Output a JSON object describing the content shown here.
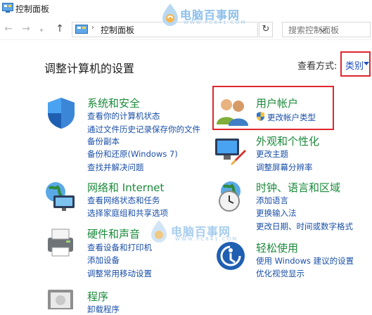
{
  "window": {
    "title": "控制面板"
  },
  "address": {
    "path": "控制面板",
    "separator": "›"
  },
  "search": {
    "placeholder": "搜索控制面板"
  },
  "watermark": {
    "brand": "电脑百事网",
    "url": "WWW.PC841.COM"
  },
  "heading": "调整计算机的设置",
  "view_by": {
    "label": "查看方式:",
    "value": "类别"
  },
  "categories": {
    "system": {
      "title": "系统和安全",
      "links": [
        "查看你的计算机状态",
        "通过文件历史记录保存你的文件",
        "备份副本",
        "备份和还原(Windows 7)",
        "查找并解决问题"
      ]
    },
    "network": {
      "title": "网络和 Internet",
      "links": [
        "查看网络状态和任务",
        "选择家庭组和共享选项"
      ]
    },
    "hardware": {
      "title": "硬件和声音",
      "links": [
        "查看设备和打印机",
        "添加设备",
        "调整常用移动设置"
      ]
    },
    "programs": {
      "title": "程序",
      "links": [
        "卸载程序"
      ]
    },
    "accounts": {
      "title": "用户帐户",
      "links": [
        "更改帐户类型"
      ]
    },
    "appearance": {
      "title": "外观和个性化",
      "links": [
        "更改主题",
        "调整屏幕分辨率"
      ]
    },
    "clock": {
      "title": "时钟、语言和区域",
      "links": [
        "添加语言",
        "更换输入法",
        "更改日期、时间或数字格式"
      ]
    },
    "ease": {
      "title": "轻松使用",
      "links": [
        "使用 Windows 建议的设置",
        "优化视觉显示"
      ]
    }
  },
  "colors": {
    "title_green": "#1a8a3a",
    "link_blue": "#1a4fa8",
    "highlight_red": "#e0262e"
  }
}
